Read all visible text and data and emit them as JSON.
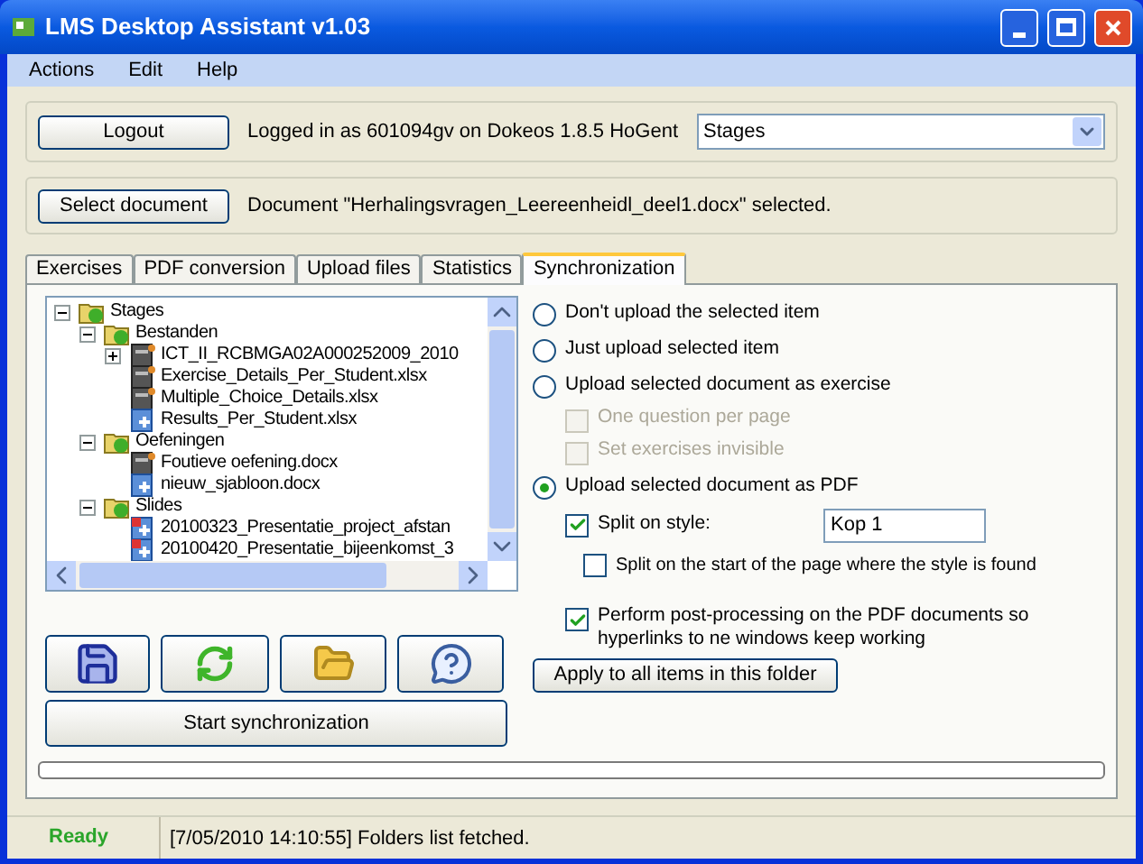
{
  "window": {
    "title": "LMS Desktop Assistant v1.03"
  },
  "menu": [
    "Actions",
    "Edit",
    "Help"
  ],
  "login": {
    "button": "Logout",
    "status": "Logged in as 601094gv on Dokeos 1.8.5 HoGent",
    "course": "Stages"
  },
  "document": {
    "button": "Select document",
    "status": "Document \"Herhalingsvragen_Leereenheidl_deel1.docx\" selected."
  },
  "tabs": [
    {
      "label": "Exercises",
      "selected": false
    },
    {
      "label": "PDF conversion",
      "selected": false
    },
    {
      "label": "Upload files",
      "selected": false
    },
    {
      "label": "Statistics",
      "selected": false
    },
    {
      "label": "Synchronization",
      "selected": true
    }
  ],
  "tree": [
    {
      "label": "Stages",
      "kind": "folder",
      "expanded": true,
      "children": [
        {
          "label": "Bestanden",
          "kind": "folder",
          "expanded": true,
          "children": [
            {
              "label": "ICT_II_RCBMGA02A000252009_2010",
              "kind": "dark",
              "expanded": false
            },
            {
              "label": "Exercise_Details_Per_Student.xlsx",
              "kind": "dark"
            },
            {
              "label": "Multiple_Choice_Details.xlsx",
              "kind": "dark"
            },
            {
              "label": "Results_Per_Student.xlsx",
              "kind": "blue"
            }
          ]
        },
        {
          "label": "Oefeningen",
          "kind": "folder",
          "expanded": true,
          "children": [
            {
              "label": "Foutieve oefening.docx",
              "kind": "dark"
            },
            {
              "label": "nieuw_sjabloon.docx",
              "kind": "blue"
            }
          ]
        },
        {
          "label": "Slides",
          "kind": "folder",
          "expanded": true,
          "children": [
            {
              "label": "20100323_Presentatie_project_afstan",
              "kind": "red"
            },
            {
              "label": "20100420_Presentatie_bijeenkomst_3",
              "kind": "red"
            }
          ]
        }
      ]
    }
  ],
  "tool_buttons": [
    "Start synchronization"
  ],
  "options": [
    {
      "kind": "radio",
      "label": "Don't upload the selected item",
      "selected": false,
      "disabled": false
    },
    {
      "kind": "radio",
      "label": "Just upload selected item",
      "selected": false,
      "disabled": false
    },
    {
      "kind": "radio",
      "label": "Upload selected document as exercise",
      "selected": false,
      "disabled": false
    },
    {
      "kind": "checkbox",
      "label": "One question per page",
      "checked": false,
      "disabled": true
    },
    {
      "kind": "checkbox",
      "label": "Set exercises invisible",
      "checked": false,
      "disabled": true
    },
    {
      "kind": "radio",
      "label": "Upload selected document as PDF",
      "selected": true,
      "disabled": false
    },
    {
      "kind": "style",
      "label": "Split on style:",
      "checked": true,
      "disabled": false,
      "value": "Kop 1"
    },
    {
      "kind": "subcheckbox",
      "label": "Split on the start of the page where the style is found",
      "checked": false,
      "disabled": false
    },
    {
      "kind": "checkbox",
      "label": "Perform post-processing on the PDF documents so hyperlinks to ne windows keep working",
      "checked": true,
      "disabled": false
    }
  ],
  "apply_button": "Apply to all items in this folder",
  "progress": {
    "level": 0
  },
  "status_bar": {
    "state": "Ready",
    "message": "[7/05/2010 14:10:55] Folders list fetched."
  }
}
